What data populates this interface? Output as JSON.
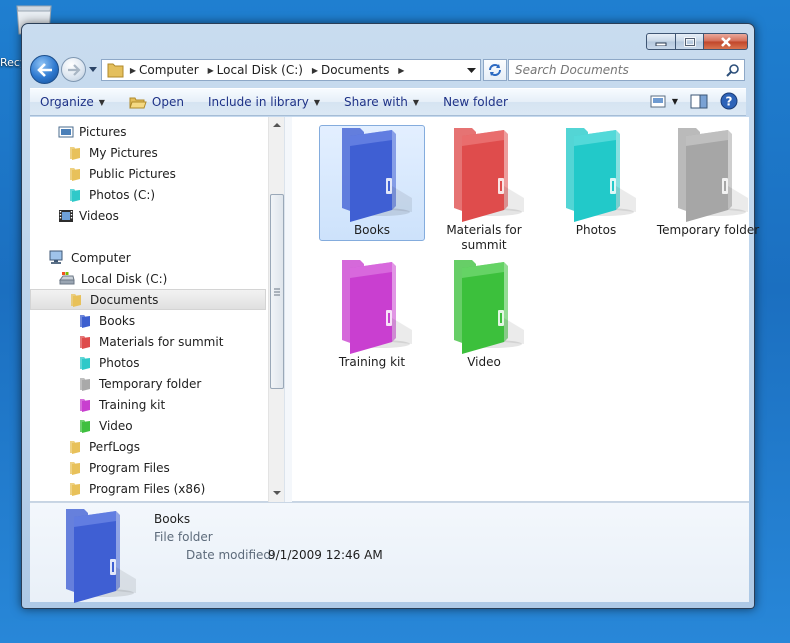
{
  "desktop": {
    "icon_label": "Recycle Bin"
  },
  "window": {
    "address": {
      "crumbs": [
        "Computer",
        "Local Disk (C:)",
        "Documents"
      ]
    },
    "search": {
      "placeholder": "Search Documents"
    },
    "toolbar": {
      "organize": "Organize",
      "open": "Open",
      "include_in_library": "Include in library",
      "share_with": "Share with",
      "new_folder": "New folder"
    },
    "nav_tree": [
      {
        "label": "Pictures",
        "icon": "pictures-library-icon",
        "color": "#4a7fb8"
      },
      {
        "label": "My Pictures",
        "icon": "folder-icon",
        "color": "#e8c15a"
      },
      {
        "label": "Public Pictures",
        "icon": "folder-icon",
        "color": "#e8c15a"
      },
      {
        "label": "Photos (C:)",
        "icon": "folder-icon",
        "color": "#2fc9c9"
      },
      {
        "label": "Videos",
        "icon": "videos-library-icon",
        "color": "#333333"
      },
      {
        "label": "Computer",
        "icon": "computer-icon",
        "color": "#5a6f86"
      },
      {
        "label": "Local Disk (C:)",
        "icon": "drive-icon",
        "color": "#8b97a5"
      },
      {
        "label": "Documents",
        "icon": "folder-icon",
        "color": "#e8c15a"
      },
      {
        "label": "Books",
        "icon": "folder-icon",
        "color": "#3d5fcf"
      },
      {
        "label": "Materials for summit",
        "icon": "folder-icon",
        "color": "#de4b4b"
      },
      {
        "label": "Photos",
        "icon": "folder-icon",
        "color": "#2fc9c9"
      },
      {
        "label": "Temporary folder",
        "icon": "folder-icon",
        "color": "#a9a9a9"
      },
      {
        "label": "Training kit",
        "icon": "folder-icon",
        "color": "#c83fcf"
      },
      {
        "label": "Video",
        "icon": "folder-icon",
        "color": "#3fbf3f"
      },
      {
        "label": "PerfLogs",
        "icon": "folder-icon",
        "color": "#e8c15a"
      },
      {
        "label": "Program Files",
        "icon": "folder-icon",
        "color": "#e8c15a"
      },
      {
        "label": "Program Files (x86)",
        "icon": "folder-icon",
        "color": "#e8c15a"
      }
    ],
    "files": [
      {
        "name": "Books",
        "color": "#3f5fd3",
        "light": "#7d95ec"
      },
      {
        "name": "Materials for summit",
        "color": "#df4c4c",
        "light": "#f08989"
      },
      {
        "name": "Photos",
        "color": "#22c9c9",
        "light": "#7be6e6"
      },
      {
        "name": "Temporary folder",
        "color": "#a6a6a6",
        "light": "#d4d4d4"
      },
      {
        "name": "Training kit",
        "color": "#c93fd0",
        "light": "#e38ae7"
      },
      {
        "name": "Video",
        "color": "#3cc03c",
        "light": "#86e286"
      }
    ],
    "details": {
      "name": "Books",
      "type": "File folder",
      "modified_label": "Date modified:",
      "modified_value": "9/1/2009 12:46 AM",
      "color": "#3f5fd3",
      "light": "#7d95ec"
    }
  }
}
